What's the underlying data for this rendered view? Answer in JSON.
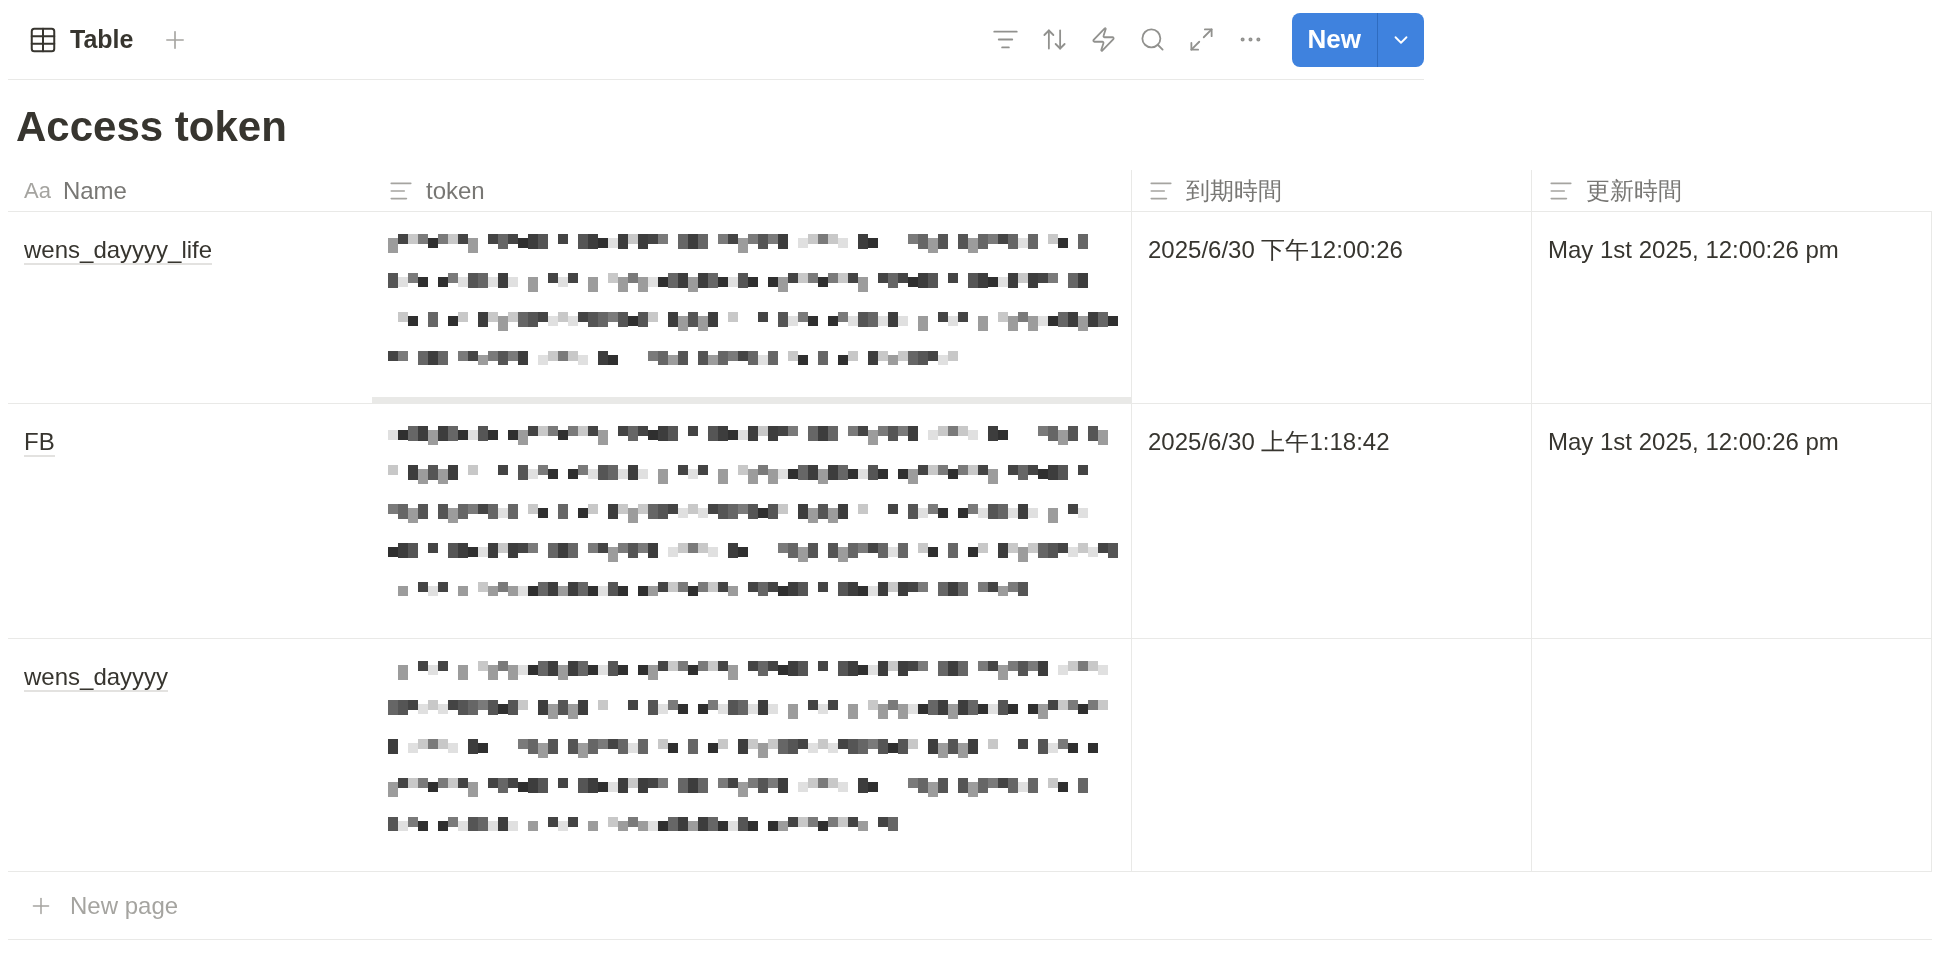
{
  "toolbar": {
    "view_tab": "Table",
    "new_button": "New"
  },
  "title": "Access token",
  "table": {
    "columns": [
      {
        "label": "Name",
        "type_mark": "Aa",
        "kind": "title"
      },
      {
        "label": "token",
        "kind": "text"
      },
      {
        "label": "到期時間",
        "kind": "text"
      },
      {
        "label": "更新時間",
        "kind": "text"
      }
    ],
    "rows": [
      {
        "name": "wens_dayyyy_life",
        "token": {
          "kind": "redacted"
        },
        "expires": "2025/6/30 下午12:00:26",
        "updated": "May 1st 2025, 12:00:26 pm"
      },
      {
        "name": "FB",
        "token": {
          "kind": "redacted"
        },
        "expires": "2025/6/30 上午1:18:42",
        "updated": "May 1st 2025, 12:00:26 pm"
      },
      {
        "name": "wens_dayyyy",
        "token": {
          "kind": "redacted"
        }
      }
    ]
  },
  "new_page": "New page"
}
